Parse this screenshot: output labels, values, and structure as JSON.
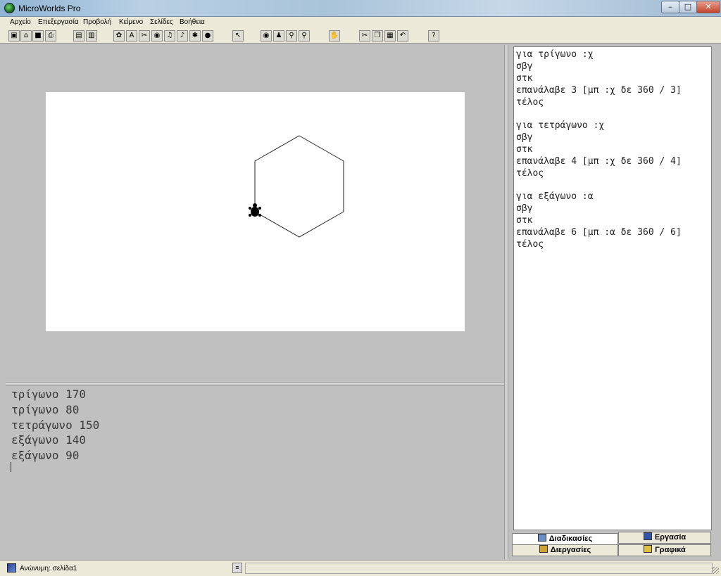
{
  "window": {
    "title": "MicroWorlds Pro"
  },
  "menu": {
    "items": [
      "Αρχείο",
      "Επεξεργασία",
      "Προβολή",
      "Κείμενο",
      "Σελίδες",
      "Βοήθεια"
    ]
  },
  "toolbar": {
    "tools": [
      "new-page-icon",
      "open-icon",
      "save-icon",
      "print-icon",
      "page-icon",
      "page2-icon",
      "turtle-tool-icon",
      "text-box-icon",
      "scissors-icon",
      "eye-icon",
      "music-icon",
      "sound-icon",
      "video-icon",
      "globe-icon",
      "pointer-icon",
      "view-icon",
      "stamp-icon",
      "zoom-in-icon",
      "zoom-out-icon",
      "stop-icon",
      "cut-icon",
      "copy-icon",
      "paste-icon",
      "undo-icon",
      "help-icon"
    ]
  },
  "command_center": {
    "lines": [
      "τρίγωνο 170",
      "τρίγωνο 80",
      "τετράγωνο 150",
      "εξάγωνο 140",
      "εξάγωνο 90"
    ]
  },
  "procedures": {
    "lines": [
      "για τρίγωνο :χ",
      "σβγ",
      "στκ",
      "επανάλαβε 3 [μπ :χ δε 360 / 3]",
      "τέλος",
      "",
      "για τετράγωνο :χ",
      "σβγ",
      "στκ",
      "επανάλαβε 4 [μπ :χ δε 360 / 4]",
      "τέλος",
      "",
      "για εξάγωνο :α",
      "σβγ",
      "στκ",
      "επανάλαβε 6 [μπ :α δε 360 / 6]",
      "τέλος"
    ]
  },
  "tabs": {
    "procedures": "Διαδικασίες",
    "project": "Εργασία",
    "processes": "Διεργασίες",
    "graphics": "Γραφικά"
  },
  "status": {
    "page": "Ανώνυμη: σελίδα1"
  }
}
